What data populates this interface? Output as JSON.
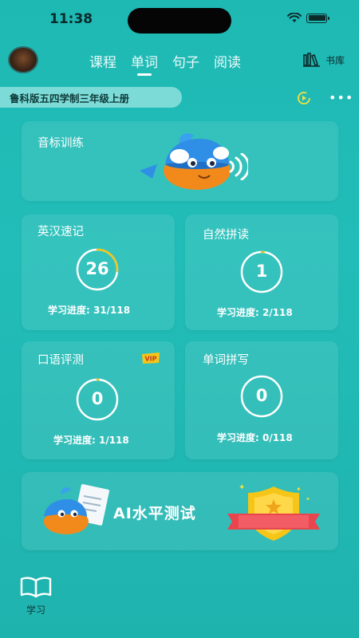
{
  "status_bar": {
    "time": "11:38"
  },
  "nav": {
    "tabs": [
      {
        "label": "课程"
      },
      {
        "label": "单词",
        "active": true
      },
      {
        "label": "句子"
      },
      {
        "label": "阅读"
      }
    ],
    "library_label": "书库"
  },
  "book": {
    "title": "鲁科版五四学制三年级上册"
  },
  "phonetics": {
    "title": "音标训练"
  },
  "modules": {
    "memorize": {
      "title": "英汉速记",
      "count": "26",
      "progress": "学习进度: 31/118",
      "progress_fraction": 0.263
    },
    "phonics": {
      "title": "自然拼读",
      "count": "1",
      "progress": "学习进度: 2/118",
      "progress_fraction": 0.017
    },
    "oral": {
      "title": "口语评测",
      "count": "0",
      "progress": "学习进度: 1/118",
      "progress_fraction": 0.008,
      "badge": "VIP"
    },
    "spelling": {
      "title": "单词拼写",
      "count": "0",
      "progress": "学习进度: 0/118",
      "progress_fraction": 0
    }
  },
  "ai_test": {
    "title": "AI水平测试"
  },
  "bottom_nav": {
    "study_label": "学习"
  },
  "colors": {
    "background": "#1fb9b4",
    "accent_yellow": "#f5c518",
    "ribbon_red": "#e8454f",
    "fish_blue": "#2f8fe6",
    "fish_orange": "#f28a1b"
  }
}
